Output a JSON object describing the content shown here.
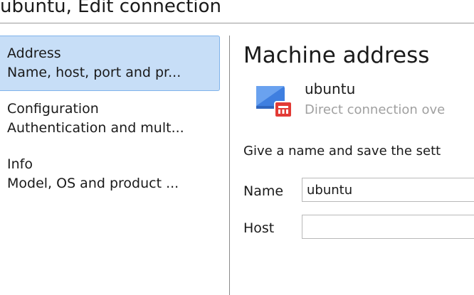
{
  "window": {
    "title": "ubuntu, Edit connection"
  },
  "sidebar": {
    "items": [
      {
        "title": "Address",
        "subtitle": "Name, host, port and pr...",
        "selected": true
      },
      {
        "title": "Configuration",
        "subtitle": "Authentication and mult...",
        "selected": false
      },
      {
        "title": "Info",
        "subtitle": "Model, OS and product ...",
        "selected": false
      }
    ]
  },
  "main": {
    "heading": "Machine address",
    "machine": {
      "name": "ubuntu",
      "description": "Direct connection ove",
      "icon": "monitor-icon",
      "badge_icon": "rdp-badge-icon",
      "colors": {
        "screen": "#3f7fe0",
        "badge": "#e23b36"
      }
    },
    "hint": "Give a name and save the sett",
    "fields": {
      "name": {
        "label": "Name",
        "value": "ubuntu"
      },
      "host": {
        "label": "Host",
        "value": "",
        "placeholder": ""
      }
    }
  },
  "colors": {
    "selection": "#c7def7",
    "selection_border": "#7fb3ea"
  }
}
